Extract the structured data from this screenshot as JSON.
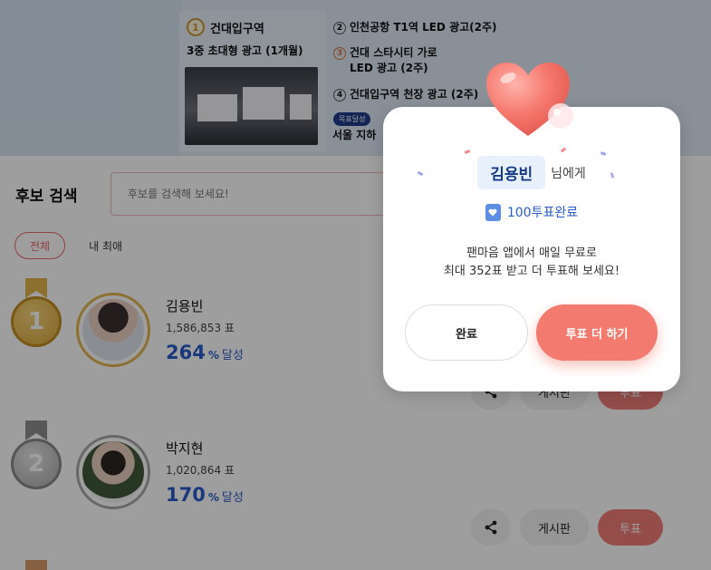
{
  "banner": {
    "main_num": "1",
    "main_title": "건대입구역",
    "main_sub": "3중 초대형 광고 (1개월)",
    "items": [
      {
        "num": "2",
        "label": "인천공항 T1역 LED 광고(2주)"
      },
      {
        "num": "3",
        "label": "건대 스타시티 가로\nLED 광고 (2주)"
      },
      {
        "num": "4",
        "label": "건대입구역 천장 광고 (2주)"
      }
    ],
    "tag": "목표달성",
    "last": "서울 지하"
  },
  "search": {
    "label": "후보 검색",
    "placeholder": "후보를 검색해 보세요!"
  },
  "filters": [
    "전체",
    "내 최애"
  ],
  "candidates": [
    {
      "rank": "1",
      "name": "김용빈",
      "votes": "1,586,853 표",
      "percent": "264",
      "unit": "%",
      "percent_label": "달성"
    },
    {
      "rank": "2",
      "name": "박지현",
      "votes": "1,020,864 표",
      "percent": "170",
      "unit": "%",
      "percent_label": "달성"
    }
  ],
  "actions": {
    "board": "게시판",
    "vote": "투표"
  },
  "modal": {
    "recipient": "김용빈",
    "recipient_suffix": "님에게",
    "vote_count": "100",
    "vote_status": "투표완료",
    "desc_line1": "팬마음 앱에서 매일 무료로",
    "desc_line2": "최대 352표 받고 더 투표해 보세요!",
    "btn_complete": "완료",
    "btn_more": "투표 더 하기"
  },
  "colors": {
    "accent": "#f37a6f",
    "brand_blue": "#2a5dc9",
    "gold": "#d9a93b",
    "silver": "#9a9a9a"
  }
}
